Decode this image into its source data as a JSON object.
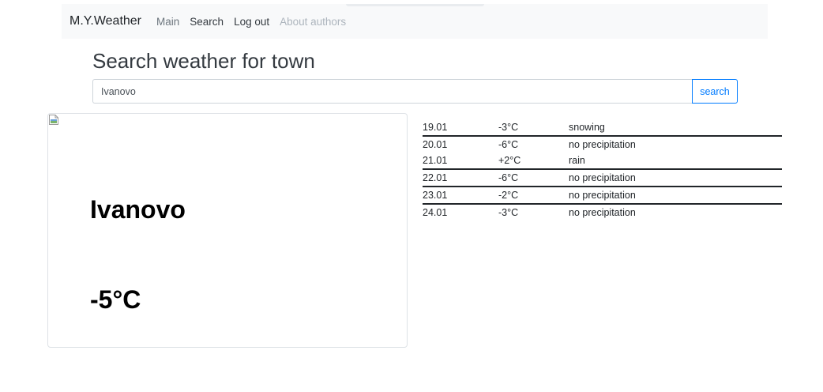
{
  "navbar": {
    "brand": "M.Y.Weather",
    "links": [
      {
        "label": "Main"
      },
      {
        "label": "Search"
      },
      {
        "label": "Log out"
      },
      {
        "label": "About authors"
      }
    ]
  },
  "page": {
    "title": "Search weather for town"
  },
  "search": {
    "value": "Ivanovo",
    "button_label": "search"
  },
  "current": {
    "city": "Ivanovo",
    "temperature": "-5°C"
  },
  "forecast": [
    {
      "date": "19.01",
      "temp": "-3°C",
      "condition": "snowing"
    },
    {
      "date": "20.01",
      "temp": "-6°C",
      "condition": "no precipitation"
    },
    {
      "date": "21.01",
      "temp": "+2°C",
      "condition": "rain"
    },
    {
      "date": "22.01",
      "temp": "-6°C",
      "condition": "no precipitation"
    },
    {
      "date": "23.01",
      "temp": "-2°C",
      "condition": "no precipitation"
    },
    {
      "date": "24.01",
      "temp": "-3°C",
      "condition": "no precipitation"
    }
  ],
  "colors": {
    "navbar_bg": "#f8f9fa",
    "link_active": "#343a40",
    "link_muted": "#adb5bd",
    "accent": "#007bff",
    "border": "#dee2e6"
  },
  "icons": {
    "weather_image": "broken-image-icon"
  }
}
